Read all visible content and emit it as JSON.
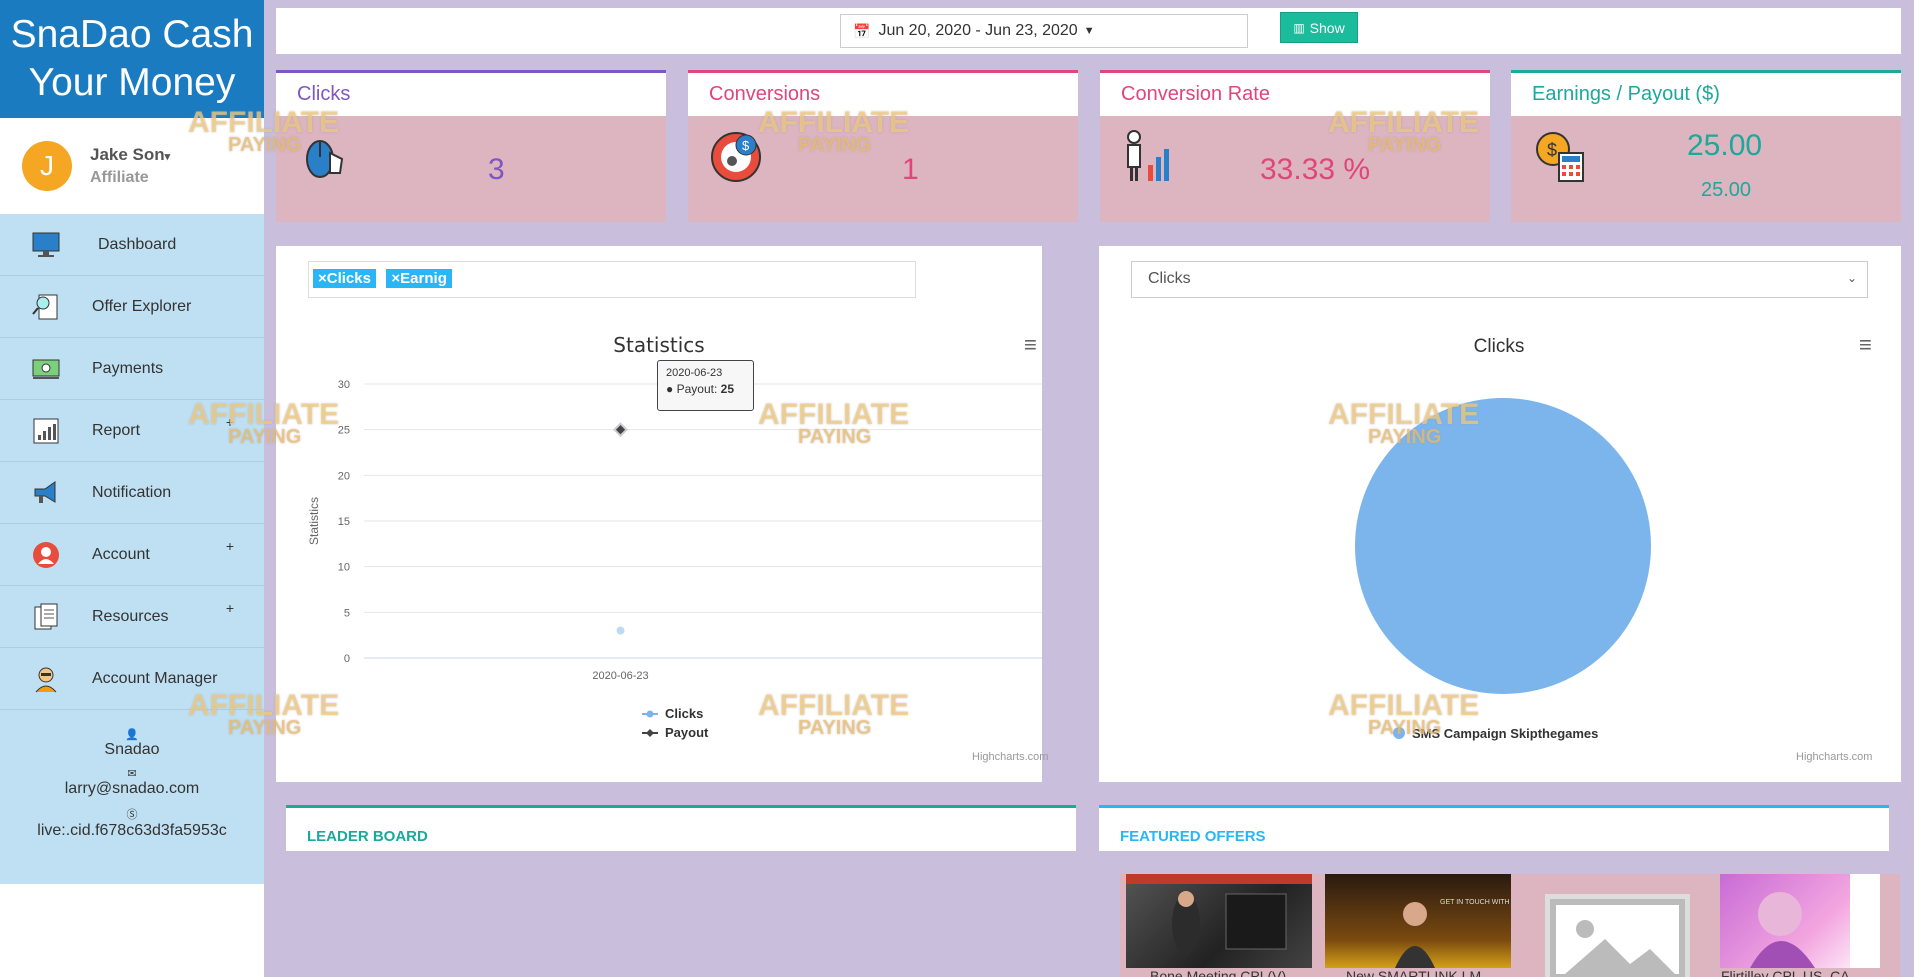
{
  "brand": {
    "line1": "SnaDao Cash",
    "line2": "Your Money"
  },
  "user": {
    "initial": "J",
    "name": "Jake Son",
    "role": "Affiliate"
  },
  "nav": [
    {
      "label": "Dashboard",
      "icon": "monitor-icon"
    },
    {
      "label": "Offer Explorer",
      "icon": "search-document-icon"
    },
    {
      "label": "Payments",
      "icon": "money-icon"
    },
    {
      "label": "Report",
      "icon": "report-chart-icon",
      "plus": "+"
    },
    {
      "label": "Notification",
      "icon": "megaphone-icon"
    },
    {
      "label": "Account",
      "icon": "account-icon",
      "plus": "+"
    },
    {
      "label": "Resources",
      "icon": "documents-icon",
      "plus": "+"
    },
    {
      "label": "Account Manager",
      "icon": "manager-icon"
    }
  ],
  "contact": {
    "name": "Snadao",
    "email": "larry@snadao.com",
    "skype": "live:.cid.f678c63d3fa5953c"
  },
  "topbar": {
    "date_range": "Jun 20, 2020 - Jun 23, 2020",
    "show_label": "Show"
  },
  "cards": [
    {
      "title": "Clicks",
      "value": "3",
      "color": "#7e57c2",
      "icon": "mouse-click-icon"
    },
    {
      "title": "Conversions",
      "value": "1",
      "color": "#e0457b",
      "icon": "conversion-icon"
    },
    {
      "title": "Conversion Rate",
      "value": "33.33 %",
      "color": "#e0457b",
      "icon": "presenter-chart-icon"
    },
    {
      "title": "Earnings / Payout ($)",
      "value": "25.00",
      "value2": "25.00",
      "color": "#1aa99a",
      "icon": "calculator-money-icon"
    }
  ],
  "stats_panel": {
    "tags": [
      "×Clicks",
      "×Earnig"
    ],
    "credits": "Highcharts.com",
    "tooltip": {
      "date": "2020-06-23",
      "series": "Payout:",
      "value": "25"
    }
  },
  "pie_panel": {
    "select_value": "Clicks",
    "credits": "Highcharts.com"
  },
  "chart_data": [
    {
      "type": "line",
      "title": "Statistics",
      "ylabel": "Statistics",
      "xlabel": "",
      "categories": [
        "2020-06-23"
      ],
      "ylim": [
        0,
        30
      ],
      "yticks": [
        0,
        5,
        10,
        15,
        20,
        25,
        30
      ],
      "series": [
        {
          "name": "Clicks",
          "values": [
            3
          ],
          "color": "#7cb5ec"
        },
        {
          "name": "Payout",
          "values": [
            25
          ],
          "color": "#434348"
        }
      ],
      "grid": true,
      "legend": "bottom"
    },
    {
      "type": "pie",
      "title": "Clicks",
      "slices": [
        {
          "name": "SMS Campaign Skipthegames",
          "value": 3,
          "color": "#7cb5ec"
        }
      ],
      "legend": "bottom"
    }
  ],
  "leader_board": {
    "title": "LEADER BOARD",
    "color": "#1aa99a"
  },
  "featured": {
    "title": "FEATURED OFFERS",
    "color": "#29b6f6",
    "offers": [
      "Bone Meeting CPL(V)",
      "New SMARTLINK LM",
      "",
      "Flirtilley CPL US, CA"
    ]
  },
  "watermark": {
    "line1": "AFFILIATE",
    "line2": "PAYING"
  }
}
